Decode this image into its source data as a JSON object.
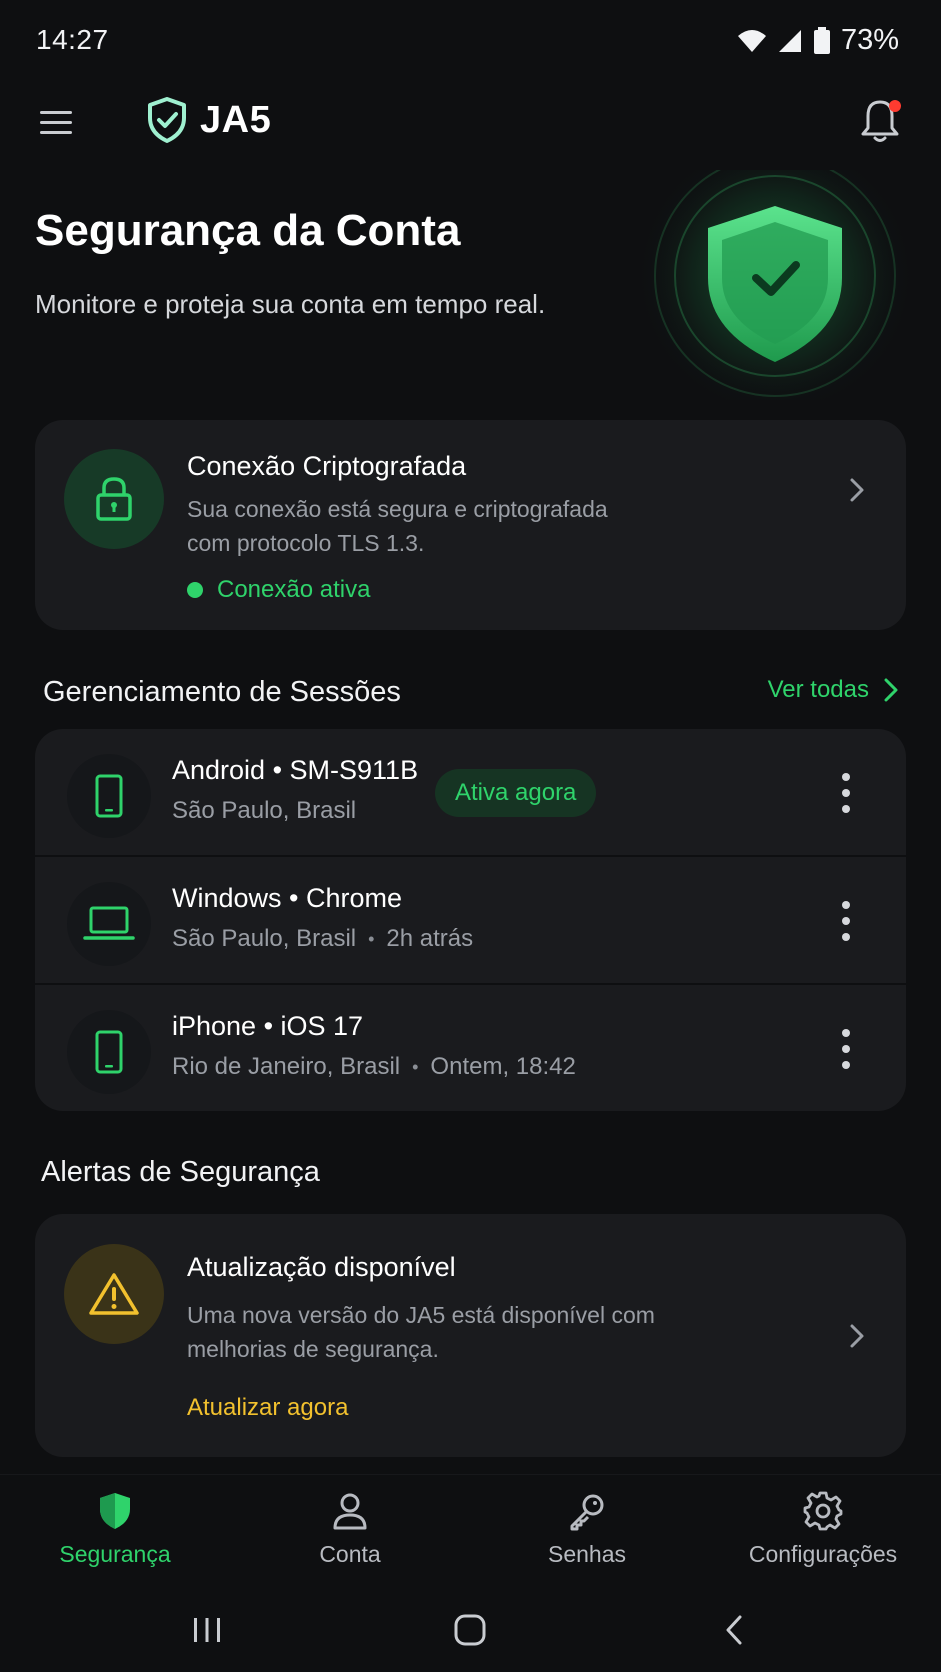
{
  "status_bar": {
    "time": "14:27",
    "battery_percent": "73%",
    "icons": [
      "wifi-icon",
      "signal-icon",
      "battery-icon"
    ]
  },
  "app_bar": {
    "brand_name": "JA5",
    "has_notification": true
  },
  "hero": {
    "title": "Segurança da Conta",
    "subtitle": "Monitore e proteja sua conta em tempo real."
  },
  "connection": {
    "title": "Conexão Criptografada",
    "description": "Sua conexão está segura e criptografada com protocolo TLS 1.3.",
    "status": "Conexão ativa",
    "status_color": "#2fd36b"
  },
  "sessions": {
    "title": "Gerenciamento de Sessões",
    "see_all": "Ver todas",
    "items": [
      {
        "name": "Android • SM-S911B",
        "location": "São Paulo, Brasil",
        "time": "",
        "badge": "Ativa agora",
        "icon": "smartphone-icon"
      },
      {
        "name": "Windows • Chrome",
        "location": "São Paulo, Brasil",
        "time": "2h atrás",
        "badge": "",
        "icon": "laptop-icon"
      },
      {
        "name": "iPhone • iOS 17",
        "location": "Rio de Janeiro, Brasil",
        "time": "Ontem, 18:42",
        "badge": "",
        "icon": "smartphone-icon"
      }
    ]
  },
  "alerts": {
    "title": "Alertas de Segurança",
    "items": [
      {
        "title": "Atualização disponível",
        "description": "Uma nova versão do JA5 está disponível com melhorias de segurança.",
        "action": "Atualizar agora",
        "icon": "warning-icon",
        "color": "#f2c12e"
      }
    ]
  },
  "bottom_nav": {
    "items": [
      {
        "label": "Segurança",
        "icon": "shield-icon",
        "active": true
      },
      {
        "label": "Conta",
        "icon": "user-icon",
        "active": false
      },
      {
        "label": "Senhas",
        "icon": "key-icon",
        "active": false
      },
      {
        "label": "Configurações",
        "icon": "gear-icon",
        "active": false
      }
    ]
  },
  "colors": {
    "accent": "#2fd36b",
    "warning": "#f2c12e",
    "background": "#0e0f11",
    "card": "#1a1b1e"
  }
}
